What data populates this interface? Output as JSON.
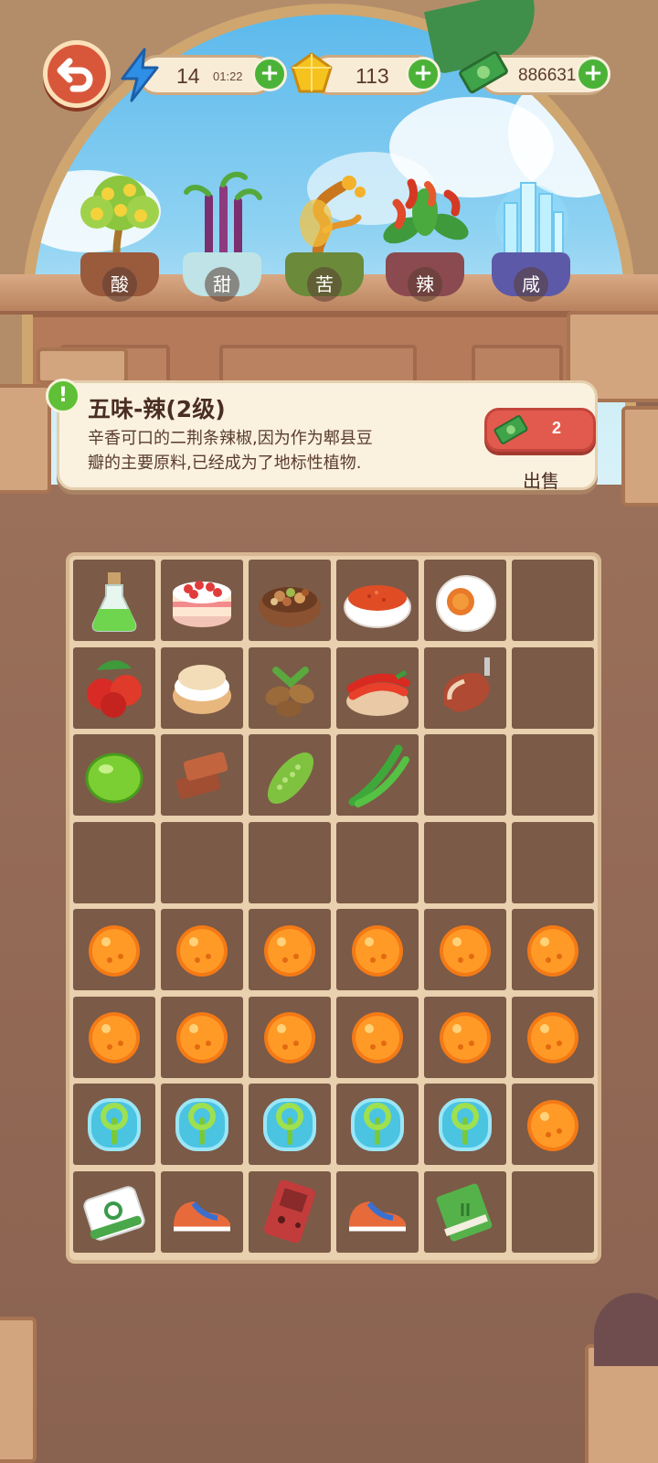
{
  "hud": {
    "back_icon": "undo-arrow-icon",
    "energy": {
      "icon": "lightning-icon",
      "value": "14",
      "timer": "01:22"
    },
    "gems": {
      "icon": "gem-icon",
      "value": "113"
    },
    "cash": {
      "icon": "cash-icon",
      "value": "886631"
    },
    "plus_icon": "plus-icon"
  },
  "plants": [
    {
      "label": "酸",
      "icon": "lemon-tree-icon"
    },
    {
      "label": "甜",
      "icon": "sugarcane-plant-icon"
    },
    {
      "label": "苦",
      "icon": "golden-bonsai-icon"
    },
    {
      "label": "辣",
      "icon": "chili-plant-icon"
    },
    {
      "label": "咸",
      "icon": "salt-crystal-icon"
    }
  ],
  "info": {
    "icon": "exclamation-icon",
    "title": "五味-辣(2级)",
    "desc_line1": "辛香可口的二荆条辣椒,因为作为郫县豆",
    "desc_line2": "瓣的主要原料,已经成为了地标性植物.",
    "sell_price": "2",
    "sell_icon": "cash-icon",
    "sell_label": "出售"
  },
  "grid": [
    [
      "green-potion-icon",
      "strawberry-cake-icon",
      "mixed-nuts-bowl-icon",
      "chili-powder-bowl-icon",
      "salted-egg-icon",
      ""
    ],
    [
      "red-berries-icon",
      "cream-puff-icon",
      "coffee-beans-icon",
      "red-chilies-bowl-icon",
      "cured-ham-icon",
      ""
    ],
    [
      "lime-icon",
      "brown-sugar-blocks-icon",
      "bitter-melon-icon",
      "green-chilies-icon",
      "",
      ""
    ],
    [
      "",
      "",
      "",
      "",
      "",
      ""
    ],
    [
      "orange-orb-icon",
      "orange-orb-icon",
      "orange-orb-icon",
      "orange-orb-icon",
      "orange-orb-icon",
      "orange-orb-icon"
    ],
    [
      "orange-orb-icon",
      "orange-orb-icon",
      "orange-orb-icon",
      "orange-orb-icon",
      "orange-orb-icon",
      "orange-orb-icon"
    ],
    [
      "sprout-bubble-icon",
      "sprout-bubble-icon",
      "sprout-bubble-icon",
      "sprout-bubble-icon",
      "sprout-bubble-icon",
      "orange-orb-icon"
    ],
    [
      "mahjong-tile-icon",
      "sneaker-icon",
      "handheld-console-icon",
      "sneaker-icon",
      "recipe-book-icon",
      ""
    ]
  ]
}
